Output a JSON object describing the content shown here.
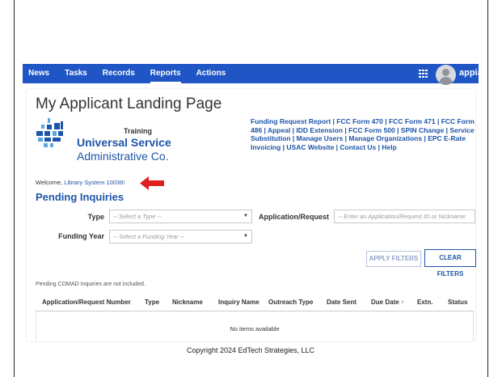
{
  "nav": {
    "items": [
      {
        "label": "News",
        "active": false
      },
      {
        "label": "Tasks",
        "active": false
      },
      {
        "label": "Records",
        "active": false
      },
      {
        "label": "Reports",
        "active": true
      },
      {
        "label": "Actions",
        "active": false
      }
    ],
    "brand": "appian",
    "bar_color": "#1f55c4"
  },
  "page": {
    "title": "My Applicant Landing Page",
    "training": "Training",
    "org_line1": "Universal Service",
    "org_line2": "Administrative Co.",
    "links": "Funding Request Report | FCC Form 470 | FCC Form 471 | FCC Form 486 | Appeal | IDD Extension | FCC Form 500 | SPIN Change | Service Substitution | Manage Users | Manage Organizations | EPC E-Rate Invoicing | USAC Website | Contact Us | Help",
    "welcome_prefix": "Welcome, ",
    "welcome_link": "Library System 10036!"
  },
  "inquiries": {
    "heading": "Pending Inquiries",
    "type_label": "Type",
    "type_placeholder": "-- Select a Type --",
    "app_label": "Application/Request",
    "app_placeholder": "-- Enter an Application/Request ID or Nickname",
    "fy_label": "Funding Year",
    "fy_placeholder": "-- Select a Funding Year --",
    "apply_label": "APPLY FILTERS",
    "clear_label": "CLEAR FILTERS",
    "note": "Pending COMAD Inquiries are not included.",
    "columns": [
      "Application/Request Number",
      "Type",
      "Nickname",
      "Inquiry Name",
      "Outreach Type",
      "Date Sent",
      "Due Date",
      "Extn.",
      "Status"
    ],
    "sort_glyph": "↑",
    "empty": "No items available"
  },
  "footer": {
    "copyright": "Copyright 2024 EdTech Strategies, LLC"
  },
  "icons": {
    "grid": "app-grid-icon",
    "avatar": "user-avatar-icon",
    "arrow": "red-arrow-icon",
    "logo": "usac-logo-icon"
  },
  "colors": {
    "brand_blue": "#1d55a8",
    "arrow_red": "#e02020"
  }
}
